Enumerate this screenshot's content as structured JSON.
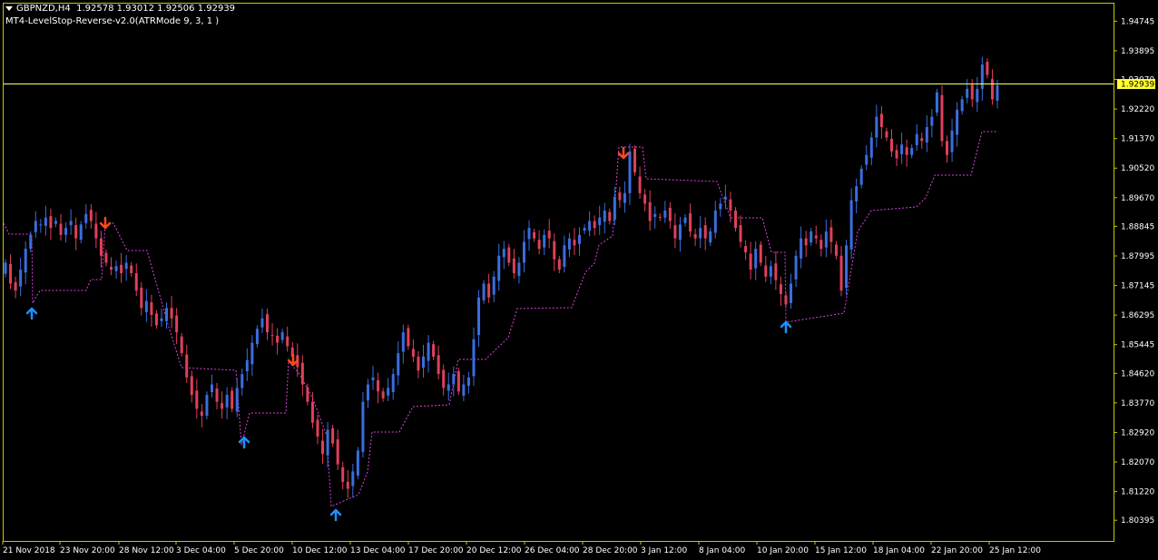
{
  "header": {
    "symbol": "GBPNZD,H4",
    "ohlc": "1.92578 1.93012 1.92506 1.92939",
    "indicator": "MT4-LevelStop-Reverse-v2.0(ATRMode 9, 3, 1 )"
  },
  "colors": {
    "background": "#000000",
    "frame": "#c8c800",
    "bull": "#3a6ee0",
    "bear": "#e0405a",
    "stop_line": "#e040e0",
    "price_line": "#ffff66",
    "arrow_up": "#1e90ff",
    "arrow_down": "#ff4a1a"
  },
  "chart_data": {
    "type": "candlestick",
    "ylim": [
      1.798,
      1.9525
    ],
    "y_ticks": [
      "1.94745",
      "1.93895",
      "1.93070",
      "1.92220",
      "1.91370",
      "1.90520",
      "1.89670",
      "1.88845",
      "1.87995",
      "1.87145",
      "1.86295",
      "1.85445",
      "1.84620",
      "1.83770",
      "1.82920",
      "1.82070",
      "1.81220",
      "1.80395"
    ],
    "x_ticks": [
      "21 Nov 2018",
      "23 Nov 20:00",
      "28 Nov 12:00",
      "3 Dec 04:00",
      "5 Dec 20:00",
      "10 Dec 12:00",
      "13 Dec 04:00",
      "17 Dec 20:00",
      "20 Dec 12:00",
      "26 Dec 04:00",
      "28 Dec 20:00",
      "3 Jan 12:00",
      "8 Jan 04:00",
      "10 Jan 20:00",
      "15 Jan 12:00",
      "18 Jan 04:00",
      "22 Jan 20:00",
      "25 Jan 12:00"
    ],
    "current_price": "1.92939",
    "close_path": [
      1.878,
      1.872,
      1.87,
      1.876,
      1.882,
      1.886,
      1.89,
      1.889,
      1.891,
      1.888,
      1.89,
      1.886,
      1.888,
      1.89,
      1.885,
      1.889,
      1.892,
      1.89,
      1.885,
      1.88,
      1.878,
      1.876,
      1.877,
      1.875,
      1.878,
      1.875,
      1.87,
      1.865,
      1.867,
      1.863,
      1.86,
      1.862,
      1.865,
      1.862,
      1.858,
      1.852,
      1.845,
      1.84,
      1.836,
      1.834,
      1.84,
      1.843,
      1.838,
      1.836,
      1.84,
      1.836,
      1.842,
      1.846,
      1.85,
      1.855,
      1.859,
      1.862,
      1.858,
      1.857,
      1.855,
      1.858,
      1.854,
      1.851,
      1.848,
      1.843,
      1.838,
      1.832,
      1.828,
      1.823,
      1.83,
      1.826,
      1.82,
      1.815,
      1.813,
      1.818,
      1.824,
      1.838,
      1.843,
      1.845,
      1.841,
      1.839,
      1.842,
      1.846,
      1.852,
      1.858,
      1.854,
      1.851,
      1.847,
      1.851,
      1.855,
      1.851,
      1.846,
      1.842,
      1.843,
      1.846,
      1.841,
      1.843,
      1.845,
      1.856,
      1.868,
      1.872,
      1.868,
      1.874,
      1.88,
      1.882,
      1.878,
      1.875,
      1.878,
      1.884,
      1.888,
      1.885,
      1.882,
      1.886,
      1.885,
      1.879,
      1.876,
      1.883,
      1.885,
      1.883,
      1.886,
      1.888,
      1.89,
      1.888,
      1.891,
      1.893,
      1.89,
      1.897,
      1.896,
      1.898,
      1.91,
      1.904,
      1.898,
      1.895,
      1.89,
      1.892,
      1.891,
      1.893,
      1.89,
      1.885,
      1.889,
      1.891,
      1.887,
      1.885,
      1.888,
      1.885,
      1.887,
      1.893,
      1.895,
      1.897,
      1.893,
      1.888,
      1.884,
      1.881,
      1.876,
      1.882,
      1.878,
      1.874,
      1.877,
      1.873,
      1.869,
      1.866,
      1.872,
      1.88,
      1.885,
      1.883,
      1.887,
      1.885,
      1.882,
      1.887,
      1.884,
      1.88,
      1.87,
      1.883,
      1.896,
      1.9,
      1.905,
      1.909,
      1.914,
      1.92,
      1.917,
      1.914,
      1.91,
      1.908,
      1.912,
      1.909,
      1.911,
      1.915,
      1.913,
      1.917,
      1.92,
      1.927,
      1.913,
      1.909,
      1.916,
      1.922,
      1.925,
      1.928,
      1.925,
      1.928,
      1.935,
      1.932,
      1.925,
      1.929
    ]
  }
}
